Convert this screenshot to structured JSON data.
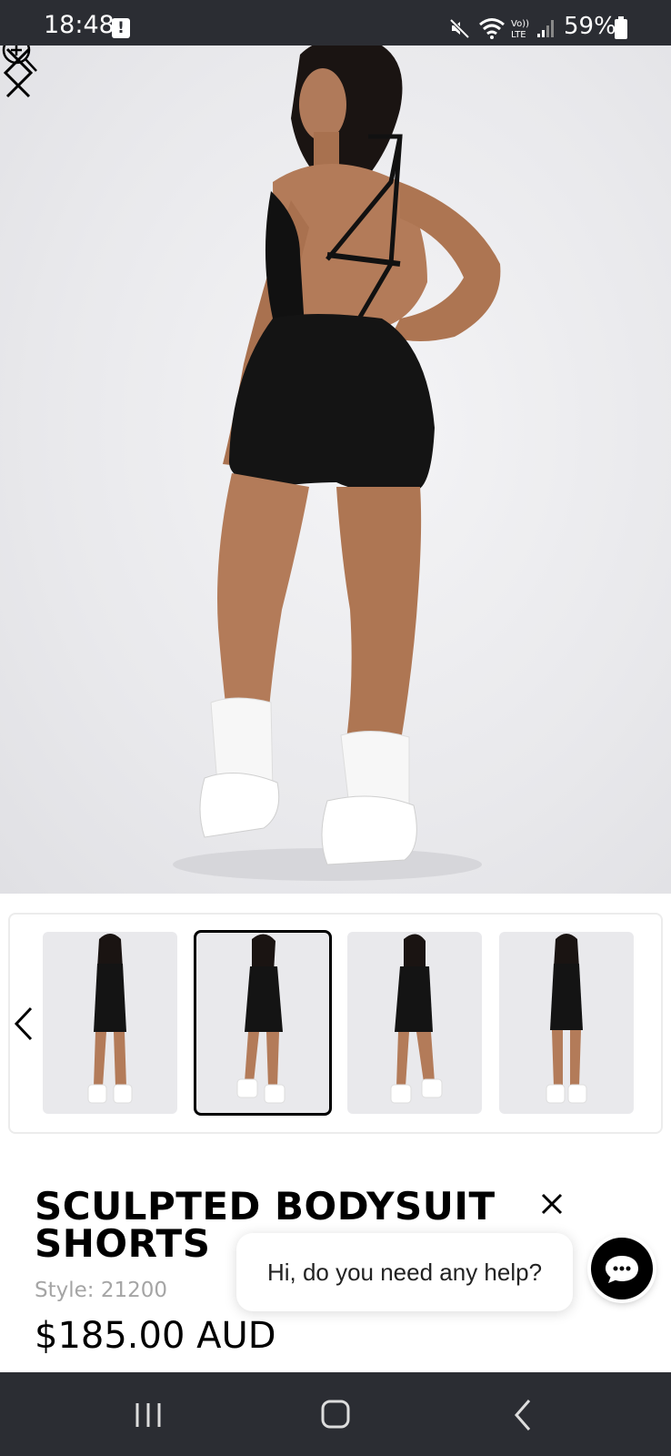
{
  "status_bar": {
    "time": "18:48",
    "alert_glyph": "!",
    "battery": "59%",
    "icons": [
      "mute-icon",
      "wifi-icon",
      "volte-icon",
      "signal-icon",
      "battery-icon"
    ]
  },
  "gallery": {
    "images": [
      "front-pose",
      "back-pose",
      "back-pose-alt",
      "front-pose-alt"
    ],
    "selected_index": 1
  },
  "product": {
    "title": "SCULPTED BODYSUIT SHORTS",
    "style": "Style: 21200",
    "price": "$185.00 AUD"
  },
  "chat": {
    "message": "Hi, do you need any help?"
  },
  "colors": {
    "status_bar_bg": "#2b2d33",
    "accent": "#000000",
    "muted_text": "#a5a5a5"
  }
}
